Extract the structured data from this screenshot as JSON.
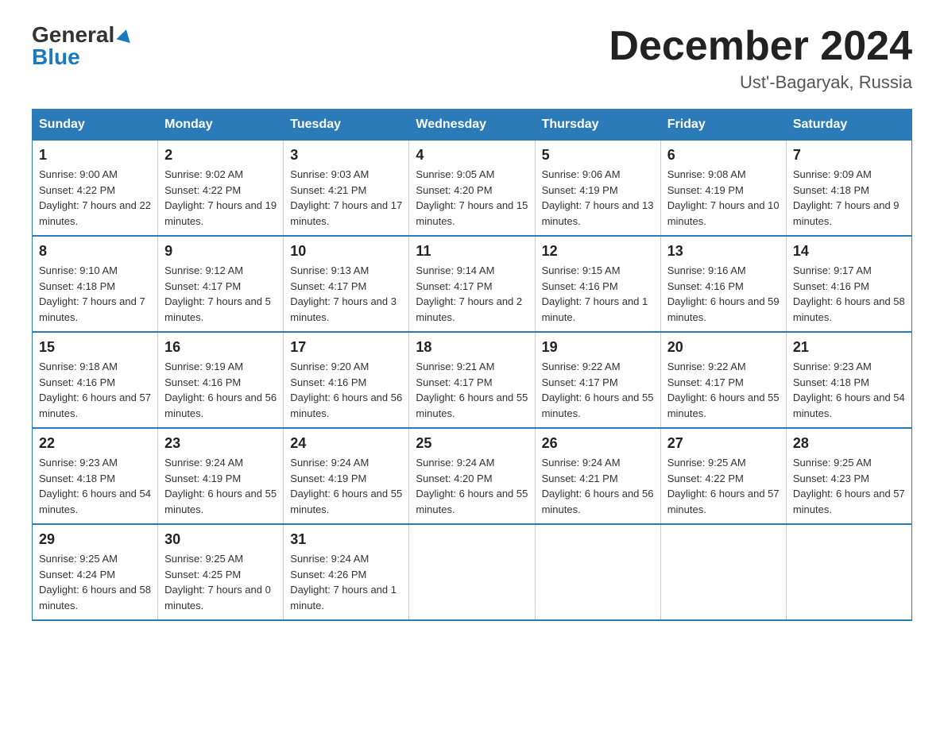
{
  "logo": {
    "general": "General",
    "blue": "Blue"
  },
  "title": "December 2024",
  "location": "Ust'-Bagaryak, Russia",
  "days_of_week": [
    "Sunday",
    "Monday",
    "Tuesday",
    "Wednesday",
    "Thursday",
    "Friday",
    "Saturday"
  ],
  "weeks": [
    [
      {
        "day": "1",
        "sunrise": "9:00 AM",
        "sunset": "4:22 PM",
        "daylight": "7 hours and 22 minutes."
      },
      {
        "day": "2",
        "sunrise": "9:02 AM",
        "sunset": "4:22 PM",
        "daylight": "7 hours and 19 minutes."
      },
      {
        "day": "3",
        "sunrise": "9:03 AM",
        "sunset": "4:21 PM",
        "daylight": "7 hours and 17 minutes."
      },
      {
        "day": "4",
        "sunrise": "9:05 AM",
        "sunset": "4:20 PM",
        "daylight": "7 hours and 15 minutes."
      },
      {
        "day": "5",
        "sunrise": "9:06 AM",
        "sunset": "4:19 PM",
        "daylight": "7 hours and 13 minutes."
      },
      {
        "day": "6",
        "sunrise": "9:08 AM",
        "sunset": "4:19 PM",
        "daylight": "7 hours and 10 minutes."
      },
      {
        "day": "7",
        "sunrise": "9:09 AM",
        "sunset": "4:18 PM",
        "daylight": "7 hours and 9 minutes."
      }
    ],
    [
      {
        "day": "8",
        "sunrise": "9:10 AM",
        "sunset": "4:18 PM",
        "daylight": "7 hours and 7 minutes."
      },
      {
        "day": "9",
        "sunrise": "9:12 AM",
        "sunset": "4:17 PM",
        "daylight": "7 hours and 5 minutes."
      },
      {
        "day": "10",
        "sunrise": "9:13 AM",
        "sunset": "4:17 PM",
        "daylight": "7 hours and 3 minutes."
      },
      {
        "day": "11",
        "sunrise": "9:14 AM",
        "sunset": "4:17 PM",
        "daylight": "7 hours and 2 minutes."
      },
      {
        "day": "12",
        "sunrise": "9:15 AM",
        "sunset": "4:16 PM",
        "daylight": "7 hours and 1 minute."
      },
      {
        "day": "13",
        "sunrise": "9:16 AM",
        "sunset": "4:16 PM",
        "daylight": "6 hours and 59 minutes."
      },
      {
        "day": "14",
        "sunrise": "9:17 AM",
        "sunset": "4:16 PM",
        "daylight": "6 hours and 58 minutes."
      }
    ],
    [
      {
        "day": "15",
        "sunrise": "9:18 AM",
        "sunset": "4:16 PM",
        "daylight": "6 hours and 57 minutes."
      },
      {
        "day": "16",
        "sunrise": "9:19 AM",
        "sunset": "4:16 PM",
        "daylight": "6 hours and 56 minutes."
      },
      {
        "day": "17",
        "sunrise": "9:20 AM",
        "sunset": "4:16 PM",
        "daylight": "6 hours and 56 minutes."
      },
      {
        "day": "18",
        "sunrise": "9:21 AM",
        "sunset": "4:17 PM",
        "daylight": "6 hours and 55 minutes."
      },
      {
        "day": "19",
        "sunrise": "9:22 AM",
        "sunset": "4:17 PM",
        "daylight": "6 hours and 55 minutes."
      },
      {
        "day": "20",
        "sunrise": "9:22 AM",
        "sunset": "4:17 PM",
        "daylight": "6 hours and 55 minutes."
      },
      {
        "day": "21",
        "sunrise": "9:23 AM",
        "sunset": "4:18 PM",
        "daylight": "6 hours and 54 minutes."
      }
    ],
    [
      {
        "day": "22",
        "sunrise": "9:23 AM",
        "sunset": "4:18 PM",
        "daylight": "6 hours and 54 minutes."
      },
      {
        "day": "23",
        "sunrise": "9:24 AM",
        "sunset": "4:19 PM",
        "daylight": "6 hours and 55 minutes."
      },
      {
        "day": "24",
        "sunrise": "9:24 AM",
        "sunset": "4:19 PM",
        "daylight": "6 hours and 55 minutes."
      },
      {
        "day": "25",
        "sunrise": "9:24 AM",
        "sunset": "4:20 PM",
        "daylight": "6 hours and 55 minutes."
      },
      {
        "day": "26",
        "sunrise": "9:24 AM",
        "sunset": "4:21 PM",
        "daylight": "6 hours and 56 minutes."
      },
      {
        "day": "27",
        "sunrise": "9:25 AM",
        "sunset": "4:22 PM",
        "daylight": "6 hours and 57 minutes."
      },
      {
        "day": "28",
        "sunrise": "9:25 AM",
        "sunset": "4:23 PM",
        "daylight": "6 hours and 57 minutes."
      }
    ],
    [
      {
        "day": "29",
        "sunrise": "9:25 AM",
        "sunset": "4:24 PM",
        "daylight": "6 hours and 58 minutes."
      },
      {
        "day": "30",
        "sunrise": "9:25 AM",
        "sunset": "4:25 PM",
        "daylight": "7 hours and 0 minutes."
      },
      {
        "day": "31",
        "sunrise": "9:24 AM",
        "sunset": "4:26 PM",
        "daylight": "7 hours and 1 minute."
      },
      null,
      null,
      null,
      null
    ]
  ]
}
